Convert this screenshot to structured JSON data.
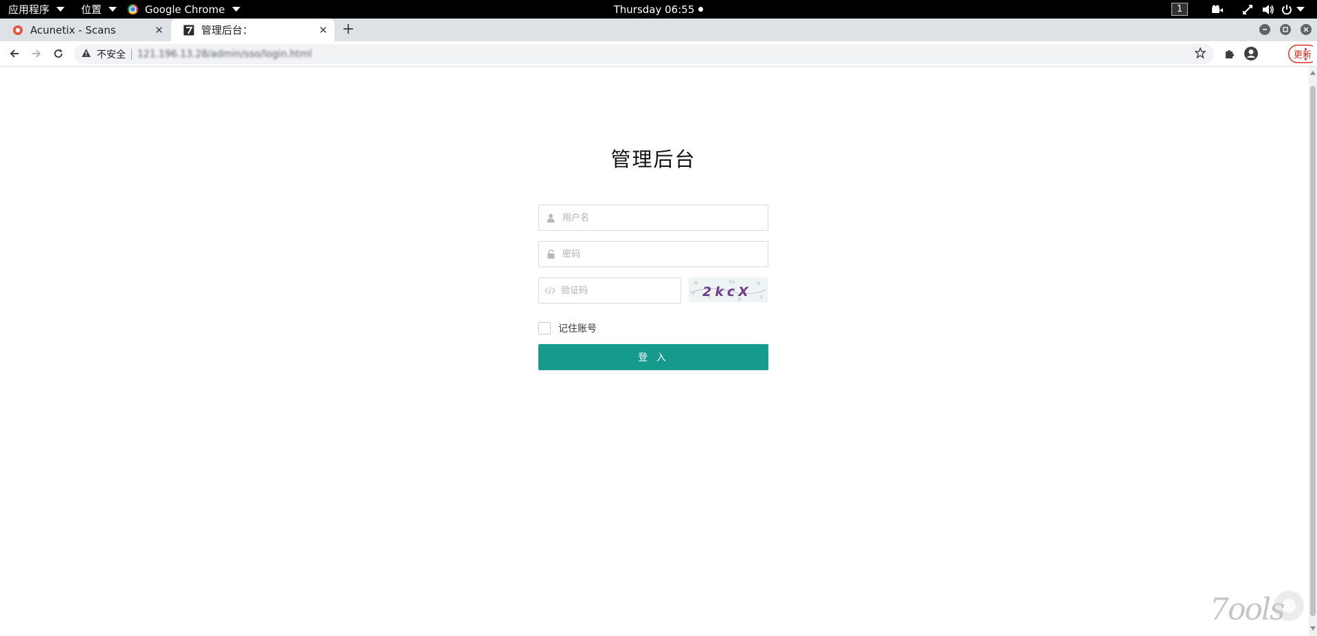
{
  "topbar": {
    "apps_menu": "应用程序",
    "places_menu": "位置",
    "app_name": "Google Chrome",
    "clock": "Thursday 06:55",
    "workspace": "1"
  },
  "tabs": [
    {
      "label": "Acunetix - Scans",
      "icon": "acunetix-icon"
    },
    {
      "label": "管理后台：",
      "icon": "site-favicon"
    }
  ],
  "toolbar": {
    "security_label": "不安全",
    "url": "121.196.13.28/admin/sso/login.html",
    "update_label": "更新"
  },
  "login": {
    "title": "管理后台",
    "username_placeholder": "用户名",
    "password_placeholder": "密码",
    "captcha_placeholder": "验证码",
    "captcha_text": "2kcX",
    "remember_label": "记住账号",
    "submit_label": "登 入"
  },
  "watermark": "7ools",
  "colors": {
    "accent": "#169a8c",
    "topbar_bg": "#000000",
    "tabstrip_bg": "#dee1e6",
    "update_red": "#d93025"
  }
}
